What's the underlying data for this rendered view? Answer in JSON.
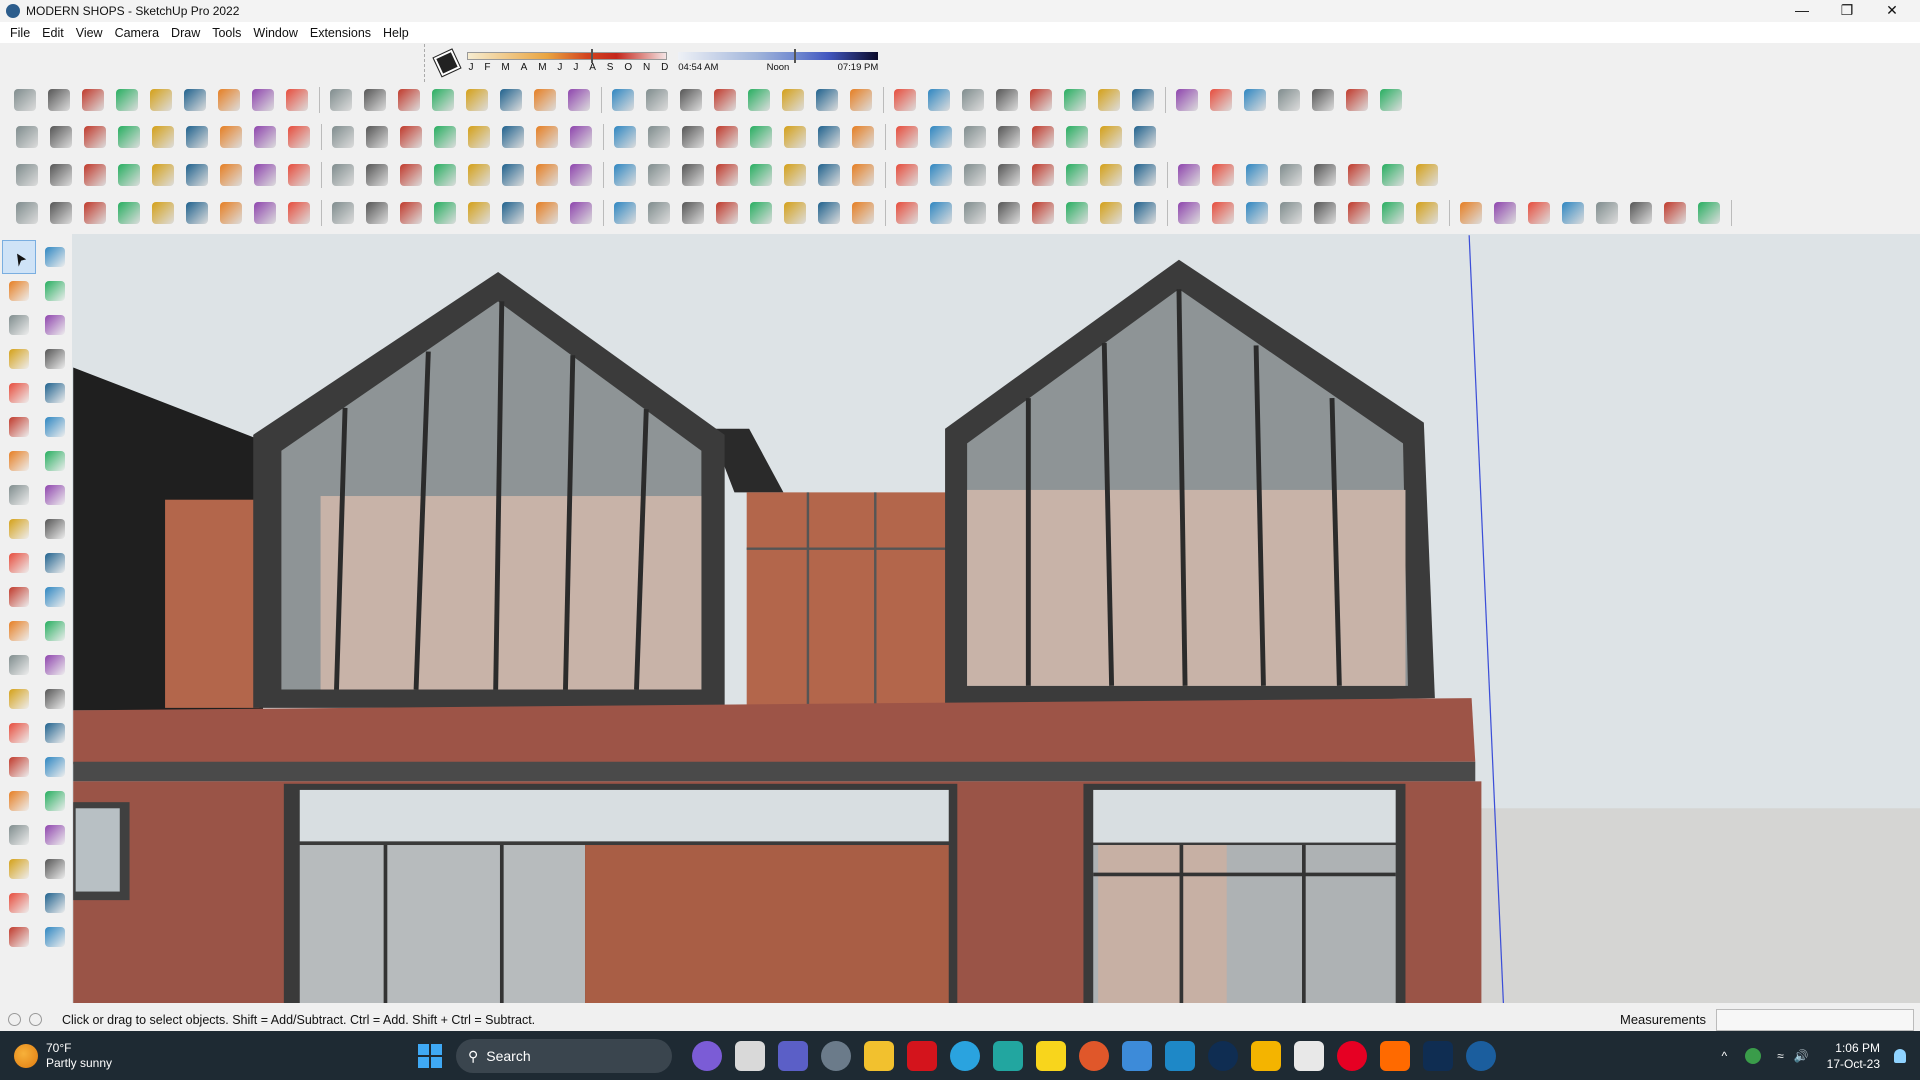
{
  "window": {
    "title": "MODERN SHOPS - SketchUp Pro 2022",
    "minimize": "—",
    "restore": "❐",
    "close": "✕"
  },
  "menu": [
    "File",
    "Edit",
    "View",
    "Camera",
    "Draw",
    "Tools",
    "Window",
    "Extensions",
    "Help"
  ],
  "shadows": {
    "months": [
      "J",
      "F",
      "M",
      "A",
      "M",
      "J",
      "J",
      "A",
      "S",
      "O",
      "N",
      "D"
    ],
    "date_fraction": 0.62,
    "sunrise": "04:54 AM",
    "noon": "Noon",
    "sunset": "07:19 PM",
    "time_fraction": 0.58
  },
  "toolbars": {
    "row1_count": 44,
    "row2_count": 36,
    "row3_count": 45,
    "row4_count": 55,
    "palette": [
      "select",
      "orbit",
      "paint-bucket",
      "eraser",
      "component",
      "tape",
      "line",
      "freehand",
      "rectangle",
      "rotated-rectangle",
      "circle",
      "polygon",
      "arc",
      "two-point-arc",
      "three-point-arc",
      "pie",
      "move",
      "push-pull",
      "rotate",
      "follow-me",
      "scale",
      "offset",
      "tape-measure",
      "dimension",
      "protractor",
      "text",
      "axes",
      "3d-text",
      "orbit-view",
      "pan",
      "zoom",
      "zoom-window",
      "zoom-extents",
      "previous",
      "position-camera",
      "look-around",
      "walk",
      "section-plane",
      "sandbox-1",
      "sandbox-2",
      "sandbox-3",
      "sandbox-4"
    ]
  },
  "status": {
    "hint": "Click or drag to select objects. Shift = Add/Subtract. Ctrl = Add. Shift + Ctrl = Subtract.",
    "measurements_label": "Measurements",
    "measurements_value": ""
  },
  "taskbar": {
    "weather_temp": "70°F",
    "weather_desc": "Partly sunny",
    "search": "Search",
    "apps": [
      "copilot",
      "task-view",
      "teams",
      "calculator",
      "file-explorer",
      "opera",
      "telegram",
      "app",
      "sticky-notes",
      "grammarly",
      "tool",
      "layout",
      "photoshop",
      "drive",
      "chrome",
      "pinterest",
      "soundcloud",
      "photoshop-2",
      "sketchup"
    ],
    "app_colors": [
      "#7b5cd6",
      "#d9d9d9",
      "#5b5fc7",
      "#6b7b8a",
      "#f2c12e",
      "#d4141c",
      "#2aa3df",
      "#22a6a0",
      "#f8d51c",
      "#e0572a",
      "#3d8bd9",
      "#1e88c7",
      "#0f2d52",
      "#f4b400",
      "#e8e8e8",
      "#e60023",
      "#ff6a00",
      "#0f2d52",
      "#1b5e9e"
    ],
    "time": "1:06 PM",
    "date": "17-Oct-23"
  },
  "colors": {
    "accent": "#0078d4",
    "brick": "#9d5447",
    "copper": "#b0644a",
    "frame": "#3b3b3b"
  }
}
